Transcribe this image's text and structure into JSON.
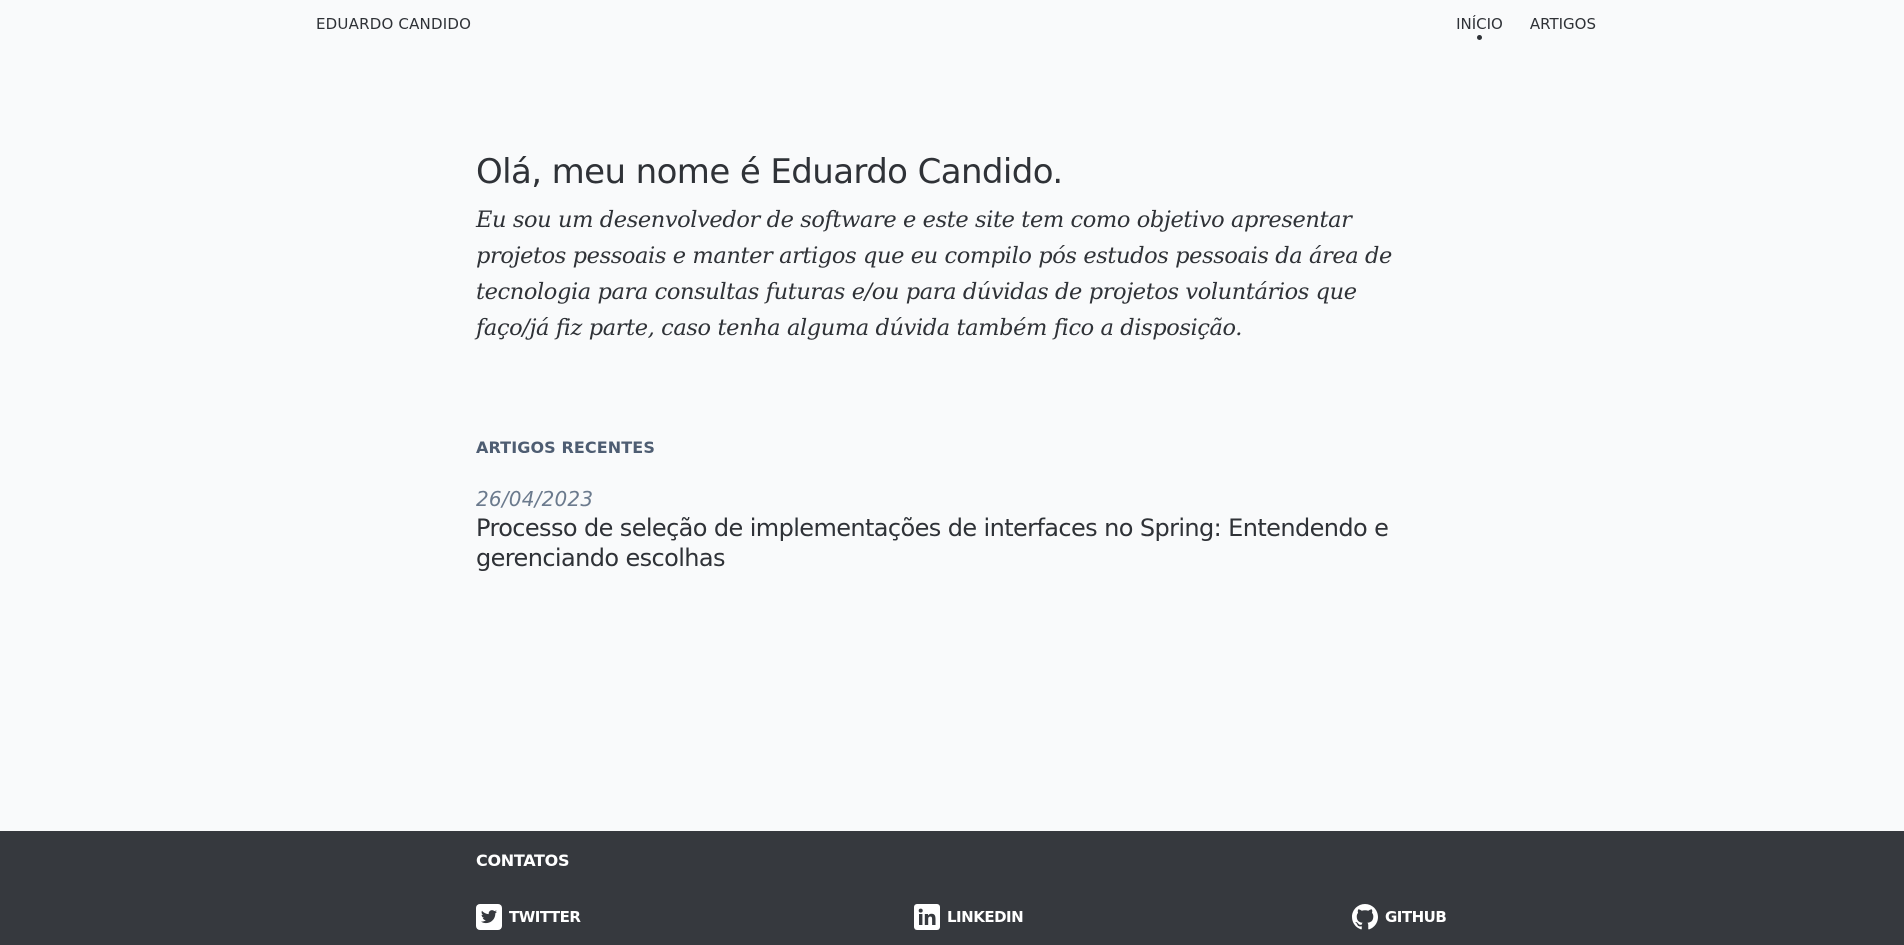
{
  "header": {
    "brand": "EDUARDO CANDIDO",
    "nav": [
      {
        "label": "INÍCIO",
        "active": true
      },
      {
        "label": "ARTIGOS",
        "active": false
      }
    ]
  },
  "hero": {
    "title": "Olá, meu nome é Eduardo Candido.",
    "text": "Eu sou um desenvolvedor de software e este site tem como objetivo apresentar projetos pessoais e manter artigos que eu compilo pós estudos pessoais da área de tecnologia para consultas futuras e/ou para dúvidas de projetos voluntários que faço/já fiz parte, caso tenha alguma dúvida também fico a disposição."
  },
  "recent": {
    "label": "ARTIGOS RECENTES",
    "posts": [
      {
        "date": "26/04/2023",
        "title": "Processo de seleção de implementações de interfaces no Spring: Entendendo e gerenciando escolhas"
      }
    ]
  },
  "footer": {
    "title": "CONTATOS",
    "contacts": [
      {
        "label": "TWITTER",
        "icon": "twitter-icon"
      },
      {
        "label": "LINKEDIN",
        "icon": "linkedin-icon"
      },
      {
        "label": "GITHUB",
        "icon": "github-icon"
      }
    ]
  },
  "colors": {
    "background": "#f9fafb",
    "text": "#2f3237",
    "muted": "#6b7a8d",
    "footer": "#36393e"
  }
}
